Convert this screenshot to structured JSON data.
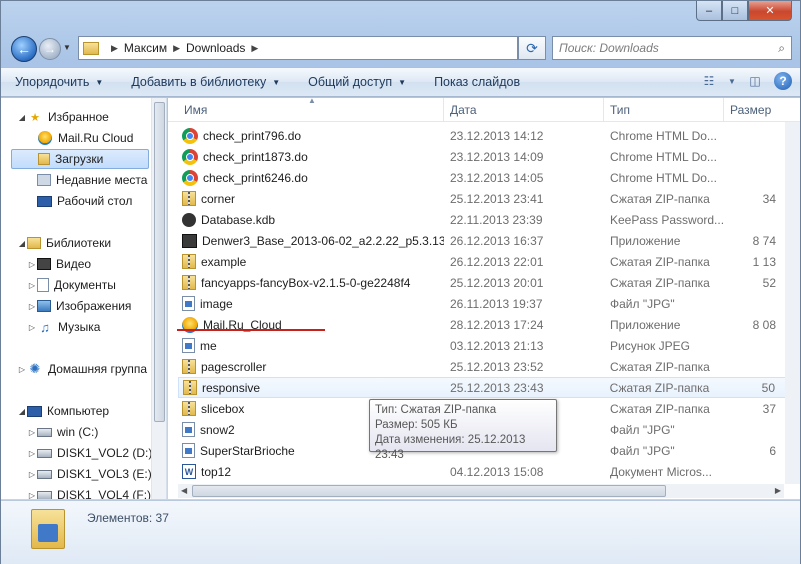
{
  "window": {
    "controls": [
      "–",
      "□",
      "✕"
    ]
  },
  "nav": {
    "back_glyph": "←",
    "forward_glyph": "→",
    "breadcrumb": [
      "Максим",
      "Downloads"
    ],
    "search_placeholder": "Поиск: Downloads"
  },
  "toolbar": {
    "items": [
      "Упорядочить",
      "Добавить в библиотеку",
      "Общий доступ",
      "Показ слайдов"
    ]
  },
  "navpane": {
    "favorites_label": "Избранное",
    "favorites": [
      "Mail.Ru Cloud",
      "Загрузки",
      "Недавние места",
      "Рабочий стол"
    ],
    "libraries_label": "Библиотеки",
    "libraries": [
      "Видео",
      "Документы",
      "Изображения",
      "Музыка"
    ],
    "homegroup_label": "Домашняя группа",
    "computer_label": "Компьютер",
    "drives": [
      "win (C:)",
      "DISK1_VOL2 (D:)",
      "DISK1_VOL3 (E:)",
      "DISK1_VOL4 (F:)"
    ]
  },
  "columns": {
    "name": "Имя",
    "date": "Дата",
    "type": "Тип",
    "size": "Размер"
  },
  "files": [
    {
      "name": "check_print796.do",
      "date": "23.12.2013 14:12",
      "type": "Chrome HTML Do...",
      "size": "",
      "icon": "chrome-icon"
    },
    {
      "name": "check_print1873.do",
      "date": "23.12.2013 14:09",
      "type": "Chrome HTML Do...",
      "size": "",
      "icon": "chrome-icon"
    },
    {
      "name": "check_print6246.do",
      "date": "23.12.2013 14:05",
      "type": "Chrome HTML Do...",
      "size": "",
      "icon": "chrome-icon"
    },
    {
      "name": "corner",
      "date": "25.12.2013 23:41",
      "type": "Сжатая ZIP-папка",
      "size": "34",
      "icon": "zip-folder-icon"
    },
    {
      "name": "Database.kdb",
      "date": "22.11.2013 23:39",
      "type": "KeePass Password...",
      "size": "",
      "icon": "lock-icon"
    },
    {
      "name": "Denwer3_Base_2013-06-02_a2.2.22_p5.3.13...",
      "date": "26.12.2013 16:37",
      "type": "Приложение",
      "size": "8 74",
      "icon": "installer-icon"
    },
    {
      "name": "example",
      "date": "26.12.2013 22:01",
      "type": "Сжатая ZIP-папка",
      "size": "1 13",
      "icon": "zip-folder-icon"
    },
    {
      "name": "fancyapps-fancyBox-v2.1.5-0-ge2248f4",
      "date": "25.12.2013 20:01",
      "type": "Сжатая ZIP-папка",
      "size": "52",
      "icon": "zip-folder-icon"
    },
    {
      "name": "image",
      "date": "26.11.2013 19:37",
      "type": "Файл \"JPG\"",
      "size": "",
      "icon": "image-file-icon"
    },
    {
      "name": "Mail.Ru_Cloud",
      "date": "28.12.2013 17:24",
      "type": "Приложение",
      "size": "8 08",
      "icon": "mailru-cloud-icon"
    },
    {
      "name": "me",
      "date": "03.12.2013 21:13",
      "type": "Рисунок JPEG",
      "size": "",
      "icon": "image-file-icon"
    },
    {
      "name": "pagescroller",
      "date": "25.12.2013 23:52",
      "type": "Сжатая ZIP-папка",
      "size": "",
      "icon": "zip-folder-icon"
    },
    {
      "name": "responsive",
      "date": "25.12.2013 23:43",
      "type": "Сжатая ZIP-папка",
      "size": "50",
      "icon": "zip-folder-icon"
    },
    {
      "name": "slicebox",
      "date": "",
      "type": "Сжатая ZIP-папка",
      "size": "37",
      "icon": "zip-folder-icon"
    },
    {
      "name": "snow2",
      "date": "",
      "type": "Файл \"JPG\"",
      "size": "",
      "icon": "image-file-icon"
    },
    {
      "name": "SuperStarBrioche",
      "date": "",
      "type": "Файл \"JPG\"",
      "size": "6",
      "icon": "image-file-icon"
    },
    {
      "name": "top12",
      "date": "04.12.2013 15:08",
      "type": "Документ Micros...",
      "size": "",
      "icon": "word-doc-icon"
    }
  ],
  "tooltip": {
    "type": "Тип: Сжатая ZIP-папка",
    "size": "Размер: 505 КБ",
    "modified": "Дата изменения: 25.12.2013 23:43"
  },
  "details": {
    "count": "Элементов: 37"
  },
  "colors": {
    "accent": "#3f79c7",
    "selection": "#c1dcfc",
    "annotation_underline": "#c8201a"
  }
}
